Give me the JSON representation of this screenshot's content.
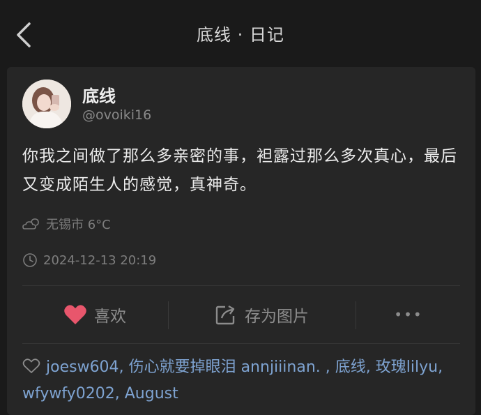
{
  "header": {
    "title": "底线 · 日记"
  },
  "post": {
    "author_name": "底线",
    "author_handle": "@ovoiki16",
    "content": "你我之间做了那么多亲密的事，袒露过那么多次真心，最后又变成陌生人的感觉，真神奇。",
    "weather": "无锡市 6°C",
    "datetime": "2024-12-13 20:19"
  },
  "actions": {
    "like_label": "喜欢",
    "save_label": "存为图片",
    "more_label": "•••"
  },
  "likers": [
    "joesw604",
    "伤心就要掉眼泪",
    "annjiiinan.",
    "底线",
    "玫瑰lilyu",
    "wfywfy0202",
    "August"
  ],
  "colors": {
    "like": "#e8566c",
    "link": "#7ea3d1",
    "background": "#1a1a1a",
    "card": "#262626"
  }
}
